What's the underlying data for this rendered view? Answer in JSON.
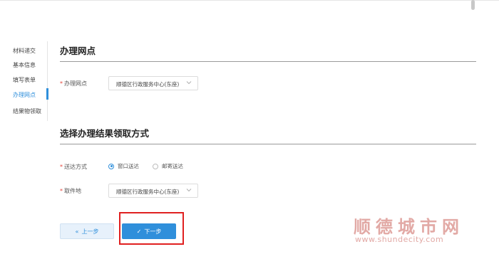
{
  "sidebar": {
    "items": [
      {
        "label": "材料递交",
        "active": false
      },
      {
        "label": "基本信息",
        "active": false
      },
      {
        "label": "填写表单",
        "active": false
      },
      {
        "label": "办理网点",
        "active": true
      },
      {
        "label": "结果物领取",
        "active": false
      }
    ]
  },
  "section1": {
    "title": "办理网点",
    "field": {
      "label": "办理网点",
      "value": "顺德区行政服务中心(东座)"
    }
  },
  "section2": {
    "title": "选择办理结果领取方式",
    "delivery": {
      "label": "送达方式",
      "options": [
        {
          "label": "窗口送达",
          "checked": true
        },
        {
          "label": "邮寄送达",
          "checked": false
        }
      ]
    },
    "pickup": {
      "label": "取件地",
      "value": "顺德区行政服务中心(东座)"
    }
  },
  "buttons": {
    "prev": {
      "icon": "«",
      "label": "上一步"
    },
    "next": {
      "icon": "✓",
      "label": "下一步"
    }
  },
  "watermark": {
    "cn": "顺德城市网",
    "url": "www.shundecity.com"
  },
  "required_mark": "*",
  "colors": {
    "accent": "#2f8fdb",
    "required": "#e5453b",
    "highlight": "#e02020",
    "watermark": "#e2a9a5"
  }
}
